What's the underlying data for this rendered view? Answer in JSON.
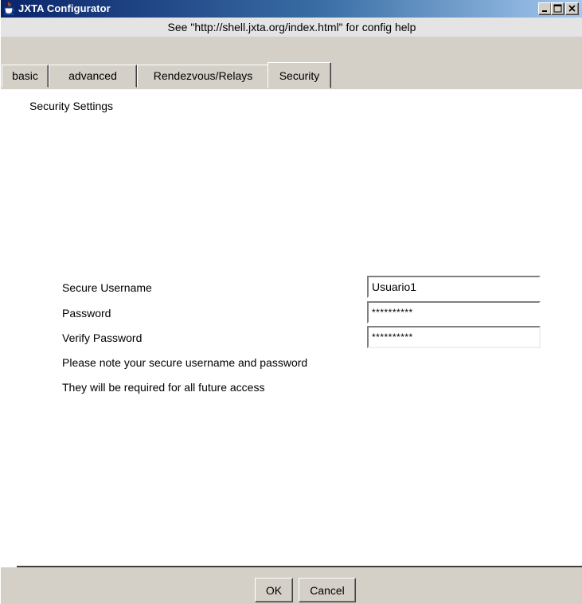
{
  "window": {
    "title": "JXTA Configurator",
    "help_text": "See \"http://shell.jxta.org/index.html\" for config help",
    "controls": {
      "minimize_icon": "minimize-icon",
      "maximize_icon": "maximize-icon",
      "close_icon": "close-icon"
    }
  },
  "tabs": [
    {
      "label": "basic",
      "active": false
    },
    {
      "label": "advanced",
      "active": false
    },
    {
      "label": "Rendezvous/Relays",
      "active": false
    },
    {
      "label": "Security",
      "active": true
    }
  ],
  "security": {
    "section_title": "Security Settings",
    "username_label": "Secure Username",
    "username_value": "Usuario1",
    "password_label": "Password",
    "password_value": "**********",
    "verify_label": "Verify Password",
    "verify_value": "**********",
    "note_line1": "Please note your secure username and password",
    "note_line2": "They will be required for all future access"
  },
  "buttons": {
    "ok": "OK",
    "cancel": "Cancel"
  },
  "colors": {
    "titlebar_start": "#0a246a",
    "titlebar_end": "#a6caf0",
    "face": "#d4d0c8"
  }
}
